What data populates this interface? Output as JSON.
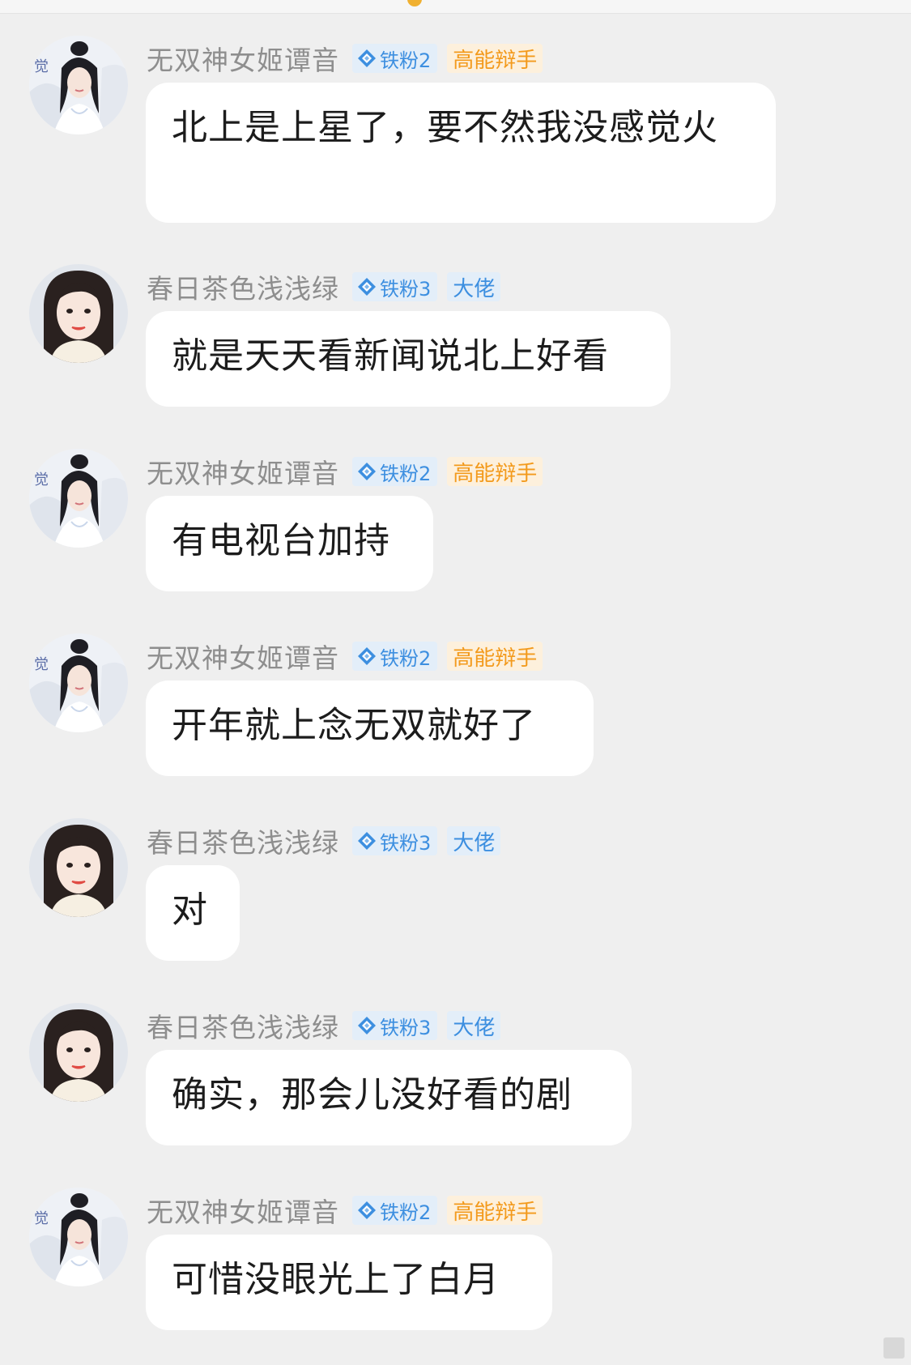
{
  "colors": {
    "background": "#efefef",
    "bubble": "#ffffff",
    "username": "#8e8e8e",
    "fan_badge_text": "#3d8fe0",
    "role_orange": "#f39a1c",
    "role_blue": "#3d8fe0"
  },
  "messages": [
    {
      "user": "无双神女姬谭音",
      "avatar": "ancient-costume-avatar",
      "fan_badge": "铁粉2",
      "role_badge": "高能辩手",
      "role_color": "orange",
      "text": "北上是上星了，要不然我没感觉火"
    },
    {
      "user": "春日茶色浅浅绿",
      "avatar": "modern-portrait-avatar",
      "fan_badge": "铁粉3",
      "role_badge": "大佬",
      "role_color": "blue",
      "text": "就是天天看新闻说北上好看"
    },
    {
      "user": "无双神女姬谭音",
      "avatar": "ancient-costume-avatar",
      "fan_badge": "铁粉2",
      "role_badge": "高能辩手",
      "role_color": "orange",
      "text": "有电视台加持"
    },
    {
      "user": "无双神女姬谭音",
      "avatar": "ancient-costume-avatar",
      "fan_badge": "铁粉2",
      "role_badge": "高能辩手",
      "role_color": "orange",
      "text": "开年就上念无双就好了"
    },
    {
      "user": "春日茶色浅浅绿",
      "avatar": "modern-portrait-avatar",
      "fan_badge": "铁粉3",
      "role_badge": "大佬",
      "role_color": "blue",
      "text": "对"
    },
    {
      "user": "春日茶色浅浅绿",
      "avatar": "modern-portrait-avatar",
      "fan_badge": "铁粉3",
      "role_badge": "大佬",
      "role_color": "blue",
      "text": "确实，那会儿没好看的剧"
    },
    {
      "user": "无双神女姬谭音",
      "avatar": "ancient-costume-avatar",
      "fan_badge": "铁粉2",
      "role_badge": "高能辩手",
      "role_color": "orange",
      "text": "可惜没眼光上了白月"
    }
  ]
}
